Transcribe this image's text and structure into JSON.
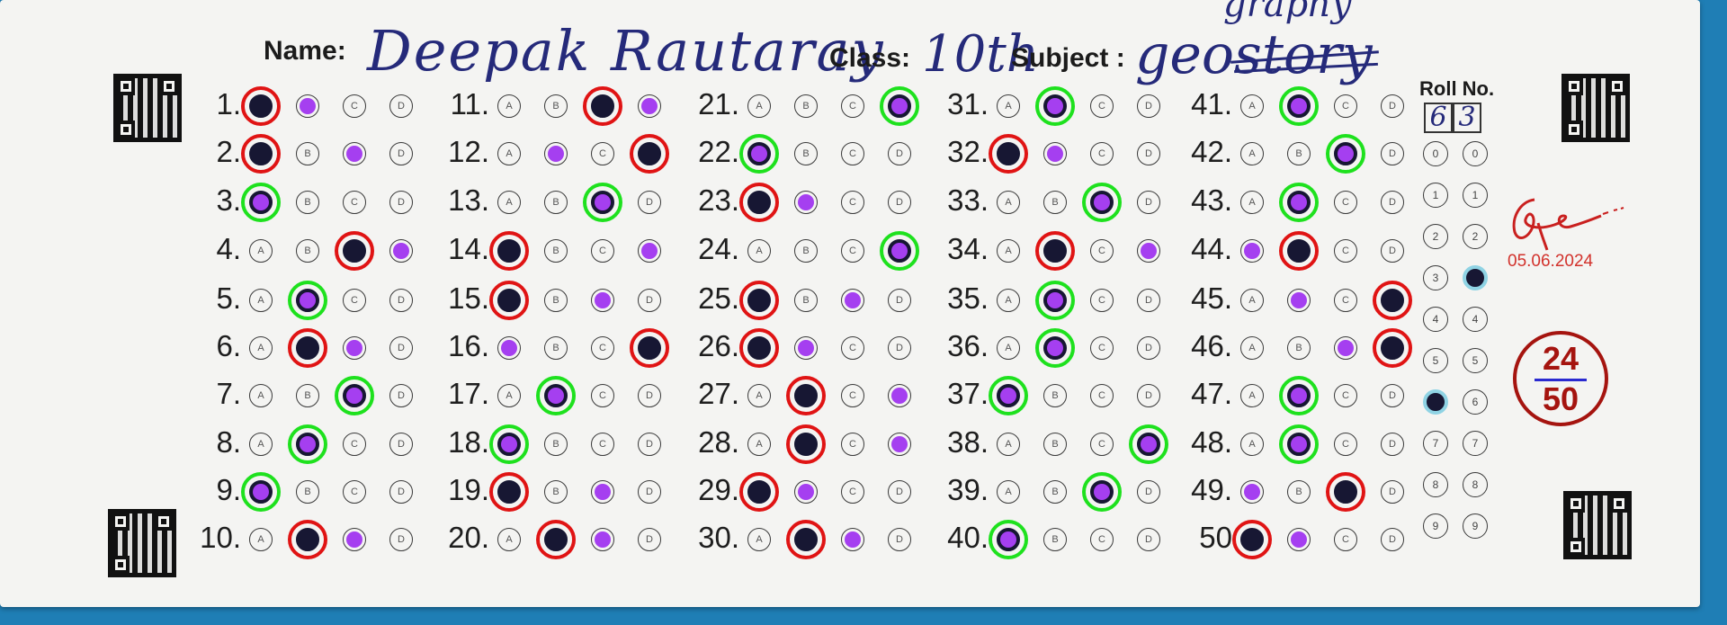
{
  "header": {
    "name_label": "Name:",
    "name_value": "Deepak Rautaray",
    "class_label": "Class:",
    "class_value": "10th",
    "subject_label": "Subject :",
    "subject_value": "geo",
    "subject_struck": "story",
    "subject_correction": "graphy"
  },
  "roll": {
    "label": "Roll No.",
    "digits": [
      "6",
      "3"
    ],
    "choices": [
      "0",
      "1",
      "2",
      "3",
      "4",
      "5",
      "6",
      "7",
      "8",
      "9"
    ]
  },
  "evaluation": {
    "date": "05.06.2024",
    "score": "24",
    "total": "50"
  },
  "choice_letters": [
    "A",
    "B",
    "C",
    "D"
  ],
  "colors": {
    "correct_ring": "#1ee11e",
    "wrong_ring": "#e01414",
    "answer_key_dot": "#a53ff0",
    "filled_bubble": "#171733",
    "score_red": "#a5140f"
  },
  "questions": [
    {
      "n": "1.",
      "marked": "A",
      "key": "B",
      "result": "wrong"
    },
    {
      "n": "2.",
      "marked": "A",
      "key": "C",
      "result": "wrong"
    },
    {
      "n": "3.",
      "marked": "A",
      "key": "A",
      "result": "correct"
    },
    {
      "n": "4.",
      "marked": "C",
      "key": "D",
      "result": "wrong"
    },
    {
      "n": "5.",
      "marked": "B",
      "key": "B",
      "result": "correct"
    },
    {
      "n": "6.",
      "marked": "B",
      "key": "C",
      "result": "wrong"
    },
    {
      "n": "7.",
      "marked": "C",
      "key": "C",
      "result": "correct"
    },
    {
      "n": "8.",
      "marked": "B",
      "key": "B",
      "result": "correct"
    },
    {
      "n": "9.",
      "marked": "A",
      "key": "A",
      "result": "correct"
    },
    {
      "n": "10.",
      "marked": "B",
      "key": "C",
      "result": "wrong"
    },
    {
      "n": "11.",
      "marked": "C",
      "key": "D",
      "result": "wrong"
    },
    {
      "n": "12.",
      "marked": "D",
      "key": "B",
      "result": "wrong"
    },
    {
      "n": "13.",
      "marked": "C",
      "key": "C",
      "result": "correct"
    },
    {
      "n": "14.",
      "marked": "A",
      "key": "D",
      "result": "wrong"
    },
    {
      "n": "15.",
      "marked": "A",
      "key": "C",
      "result": "wrong"
    },
    {
      "n": "16.",
      "marked": "D",
      "key": "A",
      "result": "wrong"
    },
    {
      "n": "17.",
      "marked": "B",
      "key": "B",
      "result": "correct"
    },
    {
      "n": "18.",
      "marked": "A",
      "key": "A",
      "result": "correct"
    },
    {
      "n": "19.",
      "marked": "A",
      "key": "C",
      "result": "wrong"
    },
    {
      "n": "20.",
      "marked": "B",
      "key": "C",
      "result": "wrong"
    },
    {
      "n": "21.",
      "marked": "D",
      "key": "D",
      "result": "correct"
    },
    {
      "n": "22.",
      "marked": "A",
      "key": "A",
      "result": "correct"
    },
    {
      "n": "23.",
      "marked": "A",
      "key": "B",
      "result": "wrong"
    },
    {
      "n": "24.",
      "marked": "D",
      "key": "D",
      "result": "correct"
    },
    {
      "n": "25.",
      "marked": "A",
      "key": "C",
      "result": "wrong"
    },
    {
      "n": "26.",
      "marked": "A",
      "key": "B",
      "result": "wrong"
    },
    {
      "n": "27.",
      "marked": "B",
      "key": "D",
      "result": "wrong"
    },
    {
      "n": "28.",
      "marked": "B",
      "key": "D",
      "result": "wrong"
    },
    {
      "n": "29.",
      "marked": "A",
      "key": "B",
      "result": "wrong"
    },
    {
      "n": "30.",
      "marked": "B",
      "key": "C",
      "result": "wrong"
    },
    {
      "n": "31.",
      "marked": "B",
      "key": "B",
      "result": "correct"
    },
    {
      "n": "32.",
      "marked": "A",
      "key": "B",
      "result": "wrong"
    },
    {
      "n": "33.",
      "marked": "C",
      "key": "C",
      "result": "correct"
    },
    {
      "n": "34.",
      "marked": "B",
      "key": "D",
      "result": "wrong"
    },
    {
      "n": "35.",
      "marked": "B",
      "key": "B",
      "result": "correct"
    },
    {
      "n": "36.",
      "marked": "B",
      "key": "B",
      "result": "correct"
    },
    {
      "n": "37.",
      "marked": "A",
      "key": "A",
      "result": "correct"
    },
    {
      "n": "38.",
      "marked": "D",
      "key": "D",
      "result": "correct"
    },
    {
      "n": "39.",
      "marked": "C",
      "key": "C",
      "result": "correct"
    },
    {
      "n": "40.",
      "marked": "A",
      "key": "A",
      "result": "correct"
    },
    {
      "n": "41.",
      "marked": "B",
      "key": "B",
      "result": "correct"
    },
    {
      "n": "42.",
      "marked": "C",
      "key": "C",
      "result": "correct"
    },
    {
      "n": "43.",
      "marked": "B",
      "key": "B",
      "result": "correct"
    },
    {
      "n": "44.",
      "marked": "B",
      "key": "A",
      "result": "wrong"
    },
    {
      "n": "45.",
      "marked": "D",
      "key": "B",
      "result": "wrong"
    },
    {
      "n": "46.",
      "marked": "D",
      "key": "C",
      "result": "wrong"
    },
    {
      "n": "47.",
      "marked": "B",
      "key": "B",
      "result": "correct"
    },
    {
      "n": "48.",
      "marked": "B",
      "key": "B",
      "result": "correct"
    },
    {
      "n": "49.",
      "marked": "C",
      "key": "A",
      "result": "wrong"
    },
    {
      "n": "50",
      "marked": "A",
      "key": "B",
      "result": "wrong"
    }
  ]
}
